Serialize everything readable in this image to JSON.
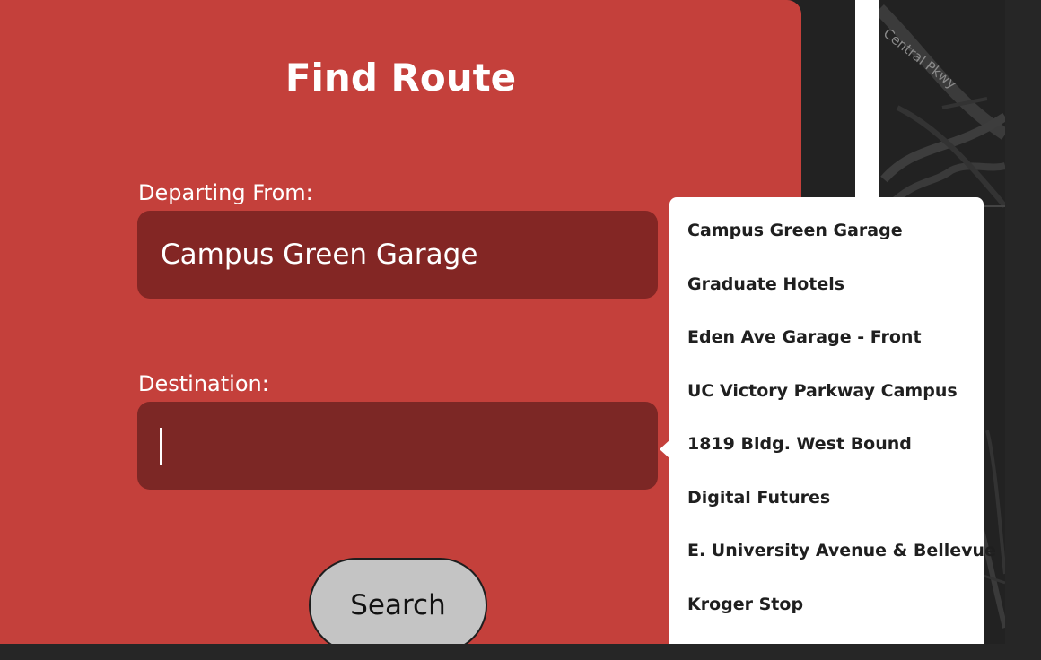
{
  "map": {
    "street_label": "Central Pkwy"
  },
  "form": {
    "title": "Find Route",
    "departing_label": "Departing From:",
    "departing_value": "Campus Green Garage",
    "destination_label": "Destination:",
    "destination_value": "",
    "search_label": "Search"
  },
  "dropdown": {
    "options": [
      "Campus Green Garage",
      "Graduate Hotels",
      "Eden Ave Garage - Front",
      "UC Victory Parkway Campus",
      "1819 Bldg. West Bound",
      "Digital Futures",
      "E. University Avenue & Bellevue",
      "Kroger Stop"
    ]
  },
  "colors": {
    "panel": "#c4403b",
    "input": "#832624",
    "button": "#c4c4c4",
    "map_background": "#222222"
  }
}
